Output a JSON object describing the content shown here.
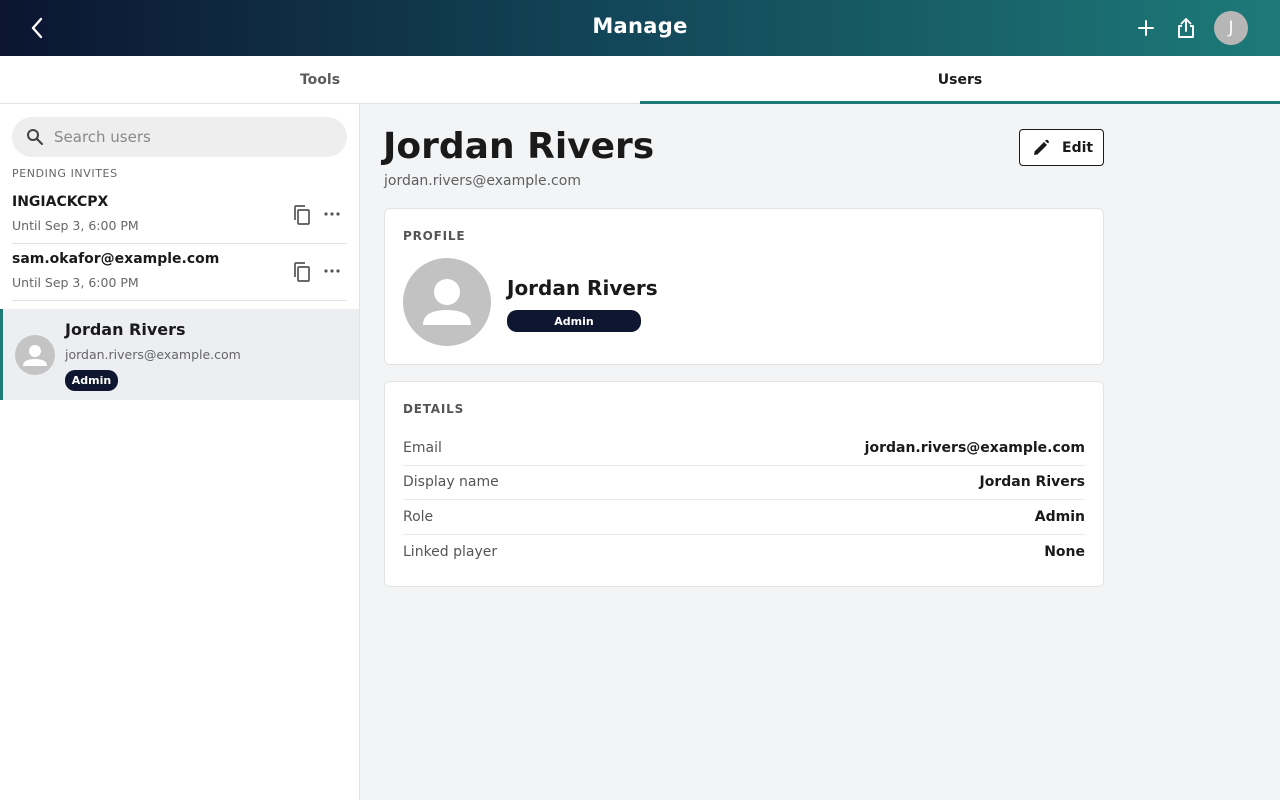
{
  "header": {
    "title": "Manage",
    "avatar_initial": "J",
    "icons": {
      "back": "chevron-left-icon",
      "add": "plus-icon",
      "share": "share-icon"
    }
  },
  "tabs": [
    {
      "label": "Tools",
      "active": false
    },
    {
      "label": "Users",
      "active": true
    }
  ],
  "sidebar": {
    "search_placeholder": "Search users",
    "pending_label": "PENDING INVITES",
    "invites": [
      {
        "code": "INGIACKCPX",
        "until": "Until Sep 3, 6:00 PM"
      },
      {
        "code": "sam.okafor@example.com",
        "until": "Until Sep 3, 6:00 PM"
      }
    ],
    "users": [
      {
        "name": "Jordan Rivers",
        "email": "jordan.rivers@example.com",
        "role": "Admin",
        "selected": true
      }
    ]
  },
  "main": {
    "name": "Jordan Rivers",
    "email": "jordan.rivers@example.com",
    "edit_label": "Edit",
    "profile": {
      "title": "PROFILE",
      "name": "Jordan Rivers",
      "role": "Admin"
    },
    "details": {
      "title": "DETAILS",
      "rows": [
        {
          "key": "Email",
          "value": "jordan.rivers@example.com"
        },
        {
          "key": "Display name",
          "value": "Jordan Rivers"
        },
        {
          "key": "Role",
          "value": "Admin"
        },
        {
          "key": "Linked player",
          "value": "None"
        }
      ]
    }
  },
  "colors": {
    "accent": "#1d7a78",
    "badge": "#0f1730",
    "header_start": "#0b1530",
    "header_end": "#1d7a78"
  }
}
